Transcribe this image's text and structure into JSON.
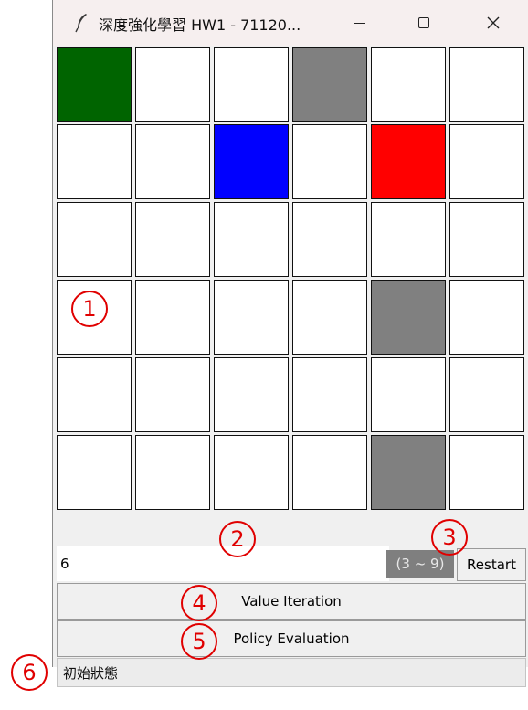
{
  "window": {
    "title": "深度強化學習 HW1 - 71120...",
    "minimize_label": "—",
    "maximize_label": "□",
    "close_label": "✕",
    "icon": "feather-icon"
  },
  "grid": {
    "rows": 6,
    "cols": 6,
    "cells": [
      [
        "#006400",
        "#ffffff",
        "#ffffff",
        "#808080",
        "#ffffff",
        "#ffffff"
      ],
      [
        "#ffffff",
        "#ffffff",
        "#0000ff",
        "#ffffff",
        "#ff0000",
        "#ffffff"
      ],
      [
        "#ffffff",
        "#ffffff",
        "#ffffff",
        "#ffffff",
        "#ffffff",
        "#ffffff"
      ],
      [
        "#ffffff",
        "#ffffff",
        "#ffffff",
        "#ffffff",
        "#808080",
        "#ffffff"
      ],
      [
        "#ffffff",
        "#ffffff",
        "#ffffff",
        "#ffffff",
        "#ffffff",
        "#ffffff"
      ],
      [
        "#ffffff",
        "#ffffff",
        "#ffffff",
        "#ffffff",
        "#808080",
        "#ffffff"
      ]
    ]
  },
  "controls": {
    "size_value": "6",
    "range_label": "(3 ~ 9)",
    "restart_label": "Restart",
    "value_iteration_label": "Value Iteration",
    "policy_evaluation_label": "Policy Evaluation",
    "status_text": "初始狀態"
  },
  "annotations": {
    "marker_1": "1",
    "marker_2": "2",
    "marker_3": "3",
    "marker_4": "4",
    "marker_5": "5",
    "marker_6": "6",
    "color": "#e00000"
  }
}
